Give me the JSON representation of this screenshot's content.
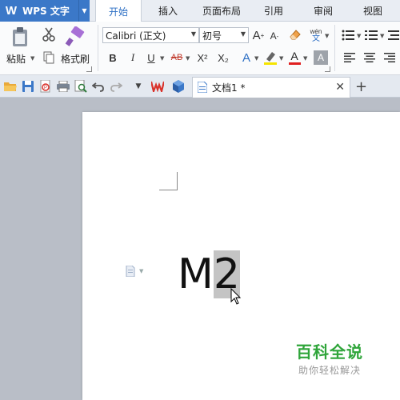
{
  "app": {
    "logo_letter": "W",
    "title": "WPS 文字"
  },
  "tabs": [
    "开始",
    "插入",
    "页面布局",
    "引用",
    "审阅",
    "视图"
  ],
  "active_tab": "开始",
  "clipboard": {
    "paste_label": "粘贴",
    "format_painter_label": "格式刷"
  },
  "font": {
    "family": "Calibri (正文)",
    "size": "初号",
    "phonetic_guide": "wén"
  },
  "format_buttons": {
    "bold": "B",
    "italic": "I",
    "underline": "U",
    "strikethrough": "AB",
    "superscript": "X²",
    "subscript": "X₂",
    "grow_font": "A",
    "shrink_font": "A",
    "text_effect": "A",
    "font_color": "A",
    "char_shading": "A"
  },
  "quick_access": {
    "icons": [
      "open-icon",
      "save-icon",
      "export-pdf-icon",
      "print-icon",
      "print-preview-icon",
      "undo-icon",
      "redo-icon"
    ]
  },
  "document_tab": {
    "title": "文档1 *"
  },
  "document": {
    "text_plain": "M",
    "text_selected": "2"
  },
  "watermark": {
    "title": "百科全说",
    "subtitle": "助你轻松解决"
  },
  "colors": {
    "accent": "#3b78c8",
    "tab_active_text": "#2d6fc4",
    "highlight_yellow": "#f5e400",
    "font_color_red": "#e02020",
    "watermark_green": "#2fa53a",
    "selection": "#c4c4c4"
  }
}
